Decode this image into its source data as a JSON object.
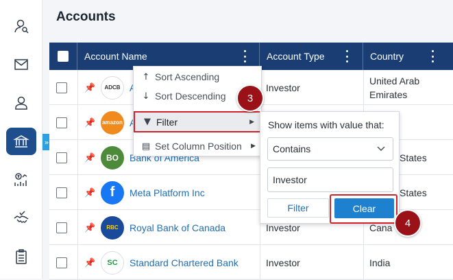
{
  "page": {
    "title": "Accounts"
  },
  "sidebar": {
    "items": [
      {
        "icon": "user-search-icon"
      },
      {
        "icon": "mail-icon"
      },
      {
        "icon": "user-icon"
      },
      {
        "icon": "bank-icon",
        "active": true
      },
      {
        "icon": "money-chart-icon"
      },
      {
        "icon": "handshake-icon"
      },
      {
        "icon": "clipboard-icon"
      }
    ],
    "expand_glyph": "»"
  },
  "grid": {
    "columns": [
      {
        "label": "Account Name"
      },
      {
        "label": "Account Type"
      },
      {
        "label": "Country"
      }
    ],
    "rows": [
      {
        "logo": "ADCB",
        "name": "A",
        "type": "Investor",
        "country": "United Arab Emirates",
        "country_line1": "United Arab",
        "country_line2": "Emirates"
      },
      {
        "logo": "amazon",
        "name": "A",
        "type": "",
        "country": ""
      },
      {
        "logo": "BO",
        "name": "Bank of America",
        "type": "",
        "country": "States"
      },
      {
        "logo": "f",
        "name": "Meta Platform Inc",
        "type": "",
        "country": "States"
      },
      {
        "logo": "RBC",
        "name": "Royal Bank of Canada",
        "type": "Investor",
        "country": "Cana"
      },
      {
        "logo": "SC",
        "name": "Standard Chartered Bank",
        "type": "Investor",
        "country": "India"
      }
    ]
  },
  "column_menu": {
    "items": [
      {
        "icon": "↑",
        "label": "Sort Ascending"
      },
      {
        "icon": "↓",
        "label": "Sort Descending"
      },
      {
        "icon": "▼",
        "label": "Filter",
        "arrow": "▶"
      },
      {
        "icon": "▤",
        "label": "Set Column Position",
        "arrow": "▶"
      }
    ]
  },
  "filter_panel": {
    "caption": "Show items with value that:",
    "operator": "Contains",
    "value": "Investor",
    "filter_label": "Filter",
    "clear_label": "Clear"
  },
  "steps": {
    "three": "3",
    "four": "4"
  },
  "colors": {
    "header": "#1a3e73",
    "accent": "#1d81cf",
    "highlight": "#d3212c",
    "step": "#9b1118"
  }
}
